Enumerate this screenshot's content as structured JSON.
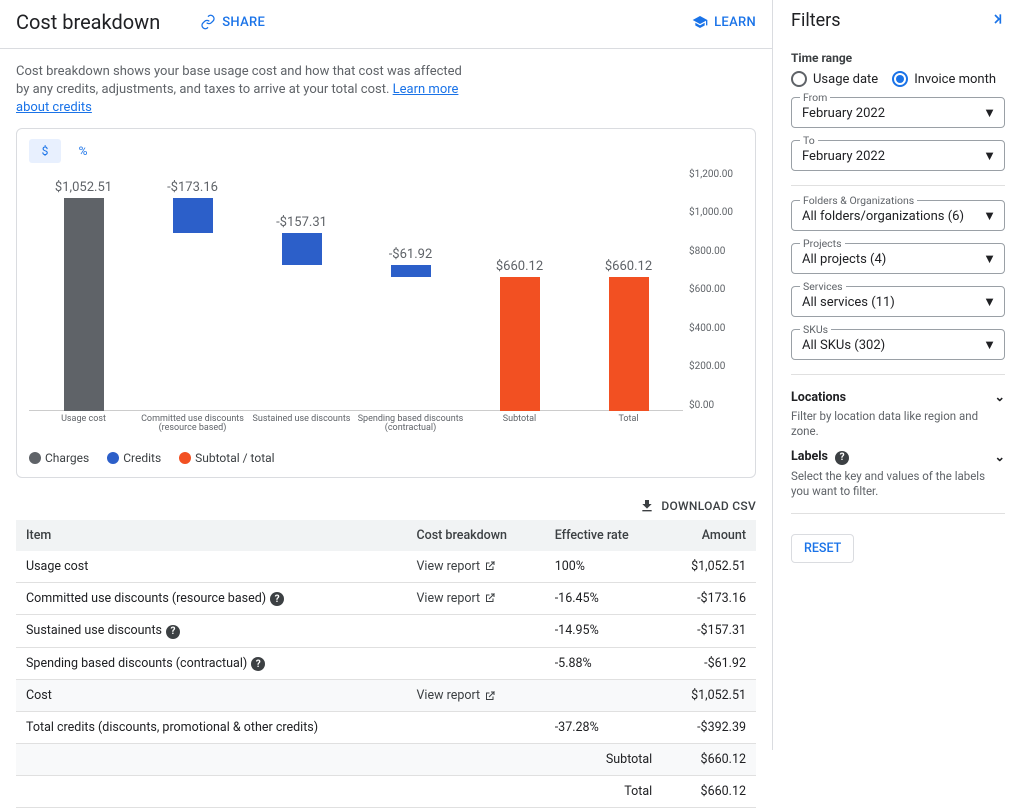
{
  "header": {
    "title": "Cost breakdown",
    "share": "SHARE",
    "learn": "LEARN"
  },
  "description": {
    "text": "Cost breakdown shows your base usage cost and how that cost was affected by any credits, adjustments, and taxes to arrive at your total cost. ",
    "link": "Learn more about credits"
  },
  "unit_tabs": {
    "dollar": "$",
    "percent": "%"
  },
  "legend": {
    "charges": "Charges",
    "credits": "Credits",
    "subtotal": "Subtotal / total"
  },
  "download": "DOWNLOAD CSV",
  "table": {
    "headers": {
      "item": "Item",
      "breakdown": "Cost breakdown",
      "rate": "Effective rate",
      "amount": "Amount"
    },
    "view_report": "View report",
    "rows": {
      "usage": {
        "item": "Usage cost",
        "rate": "100%",
        "amount": "$1,052.51"
      },
      "cud": {
        "item": "Committed use discounts (resource based)",
        "rate": "-16.45%",
        "amount": "-$173.16"
      },
      "sud": {
        "item": "Sustained use discounts",
        "rate": "-14.95%",
        "amount": "-$157.31"
      },
      "sbd": {
        "item": "Spending based discounts (contractual)",
        "rate": "-5.88%",
        "amount": "-$61.92"
      },
      "cost": {
        "item": "Cost",
        "rate": "",
        "amount": "$1,052.51"
      },
      "credits": {
        "item": "Total credits (discounts, promotional & other credits)",
        "rate": "-37.28%",
        "amount": "-$392.39"
      },
      "subtotal": {
        "item": "Subtotal",
        "amount": "$660.12"
      },
      "total": {
        "item": "Total",
        "amount": "$660.12"
      }
    }
  },
  "filters": {
    "title": "Filters",
    "time_range": "Time range",
    "usage_date": "Usage date",
    "invoice_month": "Invoice month",
    "from": {
      "label": "From",
      "value": "February 2022"
    },
    "to": {
      "label": "To",
      "value": "February 2022"
    },
    "folders": {
      "label": "Folders & Organizations",
      "value": "All folders/organizations (6)"
    },
    "projects": {
      "label": "Projects",
      "value": "All projects (4)"
    },
    "services": {
      "label": "Services",
      "value": "All services (11)"
    },
    "skus": {
      "label": "SKUs",
      "value": "All SKUs (302)"
    },
    "locations": {
      "label": "Locations",
      "sub": "Filter by location data like region and zone."
    },
    "labels": {
      "label": "Labels",
      "sub": "Select the key and values of the labels you want to filter."
    },
    "reset": "RESET"
  },
  "colors": {
    "charges": "#5f6368",
    "credits": "#2c5fc9",
    "subtotal": "#f25022",
    "link": "#1a73e8"
  },
  "chart_data": {
    "type": "bar",
    "ylabel": "",
    "ylim": [
      0,
      1200
    ],
    "yticks": [
      "$0.00",
      "$200.00",
      "$400.00",
      "$600.00",
      "$800.00",
      "$1,000.00",
      "$1,200.00"
    ],
    "categories": [
      "Usage cost",
      "Committed use discounts (resource based)",
      "Sustained use discounts",
      "Spending based discounts (contractual)",
      "Subtotal",
      "Total"
    ],
    "labels": [
      "$1,052.51",
      "-$173.16",
      "-$157.31",
      "-$61.92",
      "$660.12",
      "$660.12"
    ],
    "bars": [
      {
        "base": 0,
        "top": 1052.51,
        "color": "charges"
      },
      {
        "base": 879.35,
        "top": 1052.51,
        "color": "credits"
      },
      {
        "base": 722.04,
        "top": 879.35,
        "color": "credits"
      },
      {
        "base": 660.12,
        "top": 722.04,
        "color": "credits"
      },
      {
        "base": 0,
        "top": 660.12,
        "color": "subtotal"
      },
      {
        "base": 0,
        "top": 660.12,
        "color": "subtotal"
      }
    ]
  }
}
